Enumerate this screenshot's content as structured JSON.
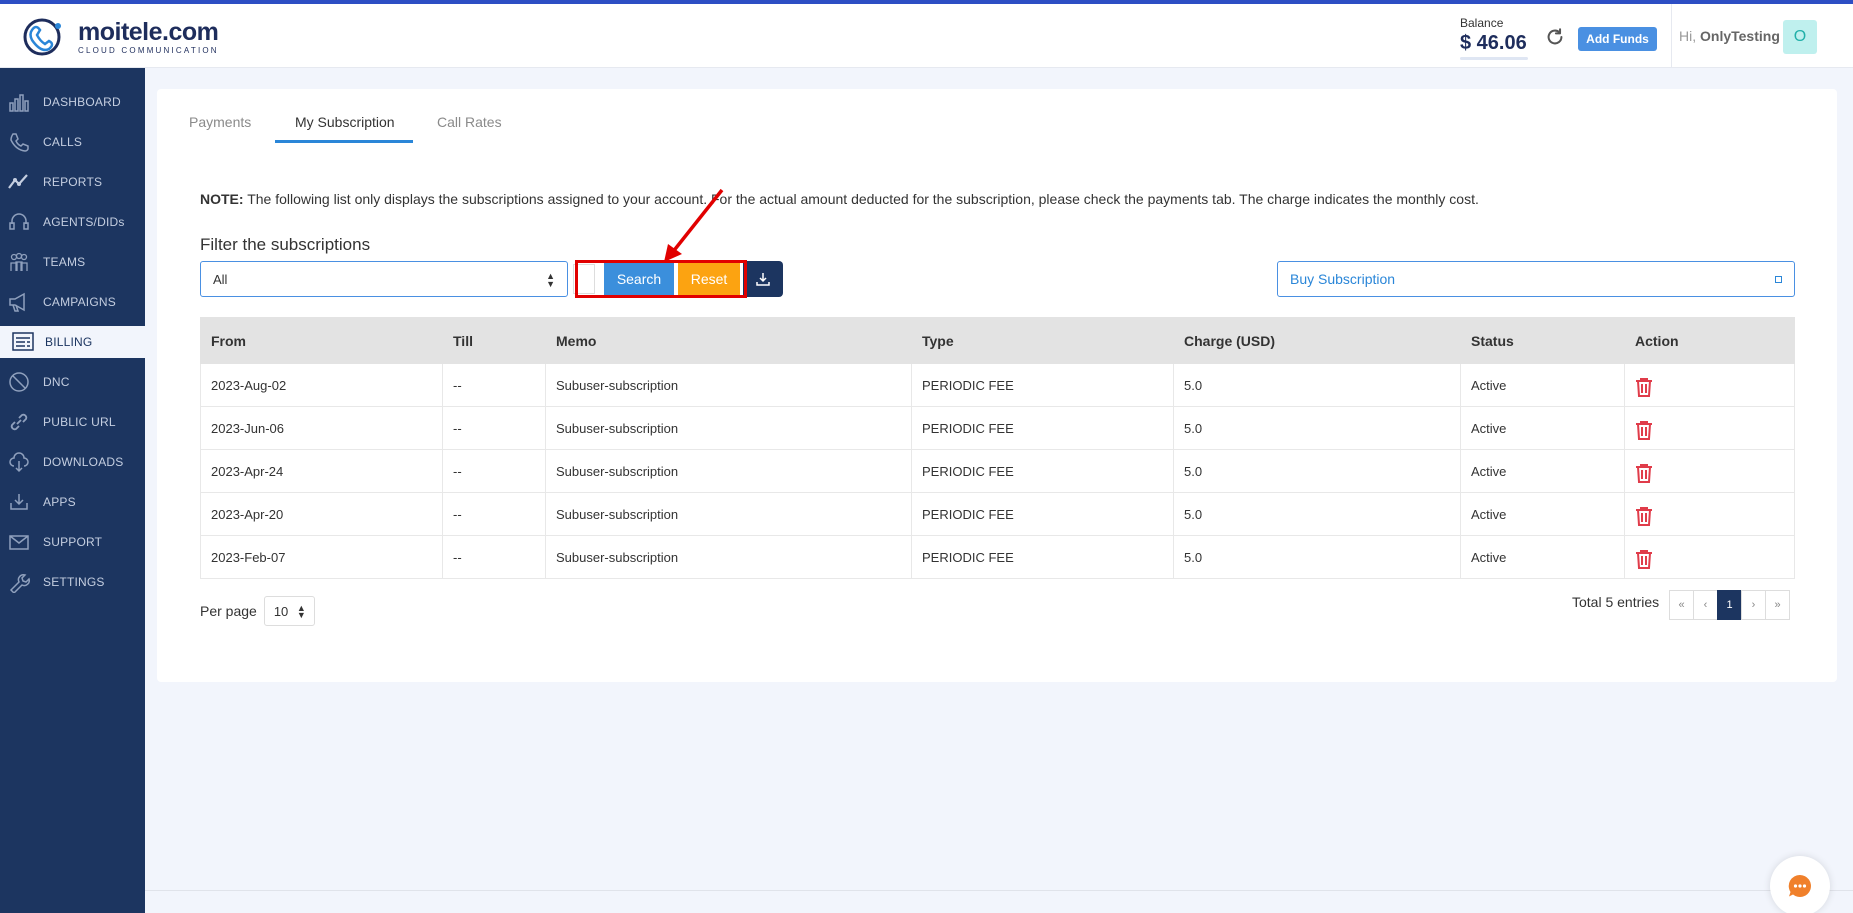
{
  "brand": {
    "name": "moitele.com",
    "tagline": "CLOUD COMMUNICATION"
  },
  "header": {
    "balance_label": "Balance",
    "balance_value": "$ 46.06",
    "add_funds_label": "Add Funds",
    "greeting_prefix": "Hi,",
    "username": "OnlyTesting",
    "avatar_initial": "O"
  },
  "sidebar": {
    "items": [
      {
        "label": "DASHBOARD",
        "icon": "dashboard-icon",
        "active": false
      },
      {
        "label": "CALLS",
        "icon": "phone-icon",
        "active": false
      },
      {
        "label": "REPORTS",
        "icon": "trend-icon",
        "active": false
      },
      {
        "label": "AGENTS/DIDs",
        "icon": "headset-icon",
        "active": false
      },
      {
        "label": "TEAMS",
        "icon": "team-icon",
        "active": false
      },
      {
        "label": "CAMPAIGNS",
        "icon": "megaphone-icon",
        "active": false
      },
      {
        "label": "BILLING",
        "icon": "invoice-icon",
        "active": true
      },
      {
        "label": "DNC",
        "icon": "block-icon",
        "active": false
      },
      {
        "label": "PUBLIC URL",
        "icon": "link-icon",
        "active": false
      },
      {
        "label": "DOWNLOADS",
        "icon": "cloud-download-icon",
        "active": false
      },
      {
        "label": "APPS",
        "icon": "app-download-icon",
        "active": false
      },
      {
        "label": "SUPPORT",
        "icon": "mail-icon",
        "active": false
      },
      {
        "label": "SETTINGS",
        "icon": "wrench-icon",
        "active": false
      }
    ]
  },
  "tabs": [
    {
      "label": "Payments",
      "active": false
    },
    {
      "label": "My Subscription",
      "active": true
    },
    {
      "label": "Call Rates",
      "active": false
    }
  ],
  "note": {
    "prefix": "NOTE:",
    "text": " The following list only displays the subscriptions assigned to your account. For the actual amount deducted for the subscription, please check the payments tab. The charge indicates the monthly cost."
  },
  "filter": {
    "title": "Filter the subscriptions",
    "selected": "All",
    "search_label": "Search",
    "reset_label": "Reset",
    "buy_label": "Buy Subscription"
  },
  "table": {
    "columns": [
      "From",
      "Till",
      "Memo",
      "Type",
      "Charge (USD)",
      "Status",
      "Action"
    ],
    "rows": [
      {
        "from": "2023-Aug-02",
        "till": "--",
        "memo": "Subuser-subscription",
        "type": "PERIODIC FEE",
        "charge": "5.0",
        "status": "Active"
      },
      {
        "from": "2023-Jun-06",
        "till": "--",
        "memo": "Subuser-subscription",
        "type": "PERIODIC FEE",
        "charge": "5.0",
        "status": "Active"
      },
      {
        "from": "2023-Apr-24",
        "till": "--",
        "memo": "Subuser-subscription",
        "type": "PERIODIC FEE",
        "charge": "5.0",
        "status": "Active"
      },
      {
        "from": "2023-Apr-20",
        "till": "--",
        "memo": "Subuser-subscription",
        "type": "PERIODIC FEE",
        "charge": "5.0",
        "status": "Active"
      },
      {
        "from": "2023-Feb-07",
        "till": "--",
        "memo": "Subuser-subscription",
        "type": "PERIODIC FEE",
        "charge": "5.0",
        "status": "Active"
      }
    ]
  },
  "pagination": {
    "per_page_label": "Per page",
    "per_page_value": "10",
    "total_text": "Total 5 entries",
    "first": "«",
    "prev": "‹",
    "current": "1",
    "next": "›",
    "last": "»"
  },
  "colors": {
    "sidebar": "#1c3560",
    "accent": "#2a86d8",
    "search": "#3b8fdc",
    "reset": "#fca311",
    "danger": "#e03c4a",
    "highlight": "#e10000"
  }
}
